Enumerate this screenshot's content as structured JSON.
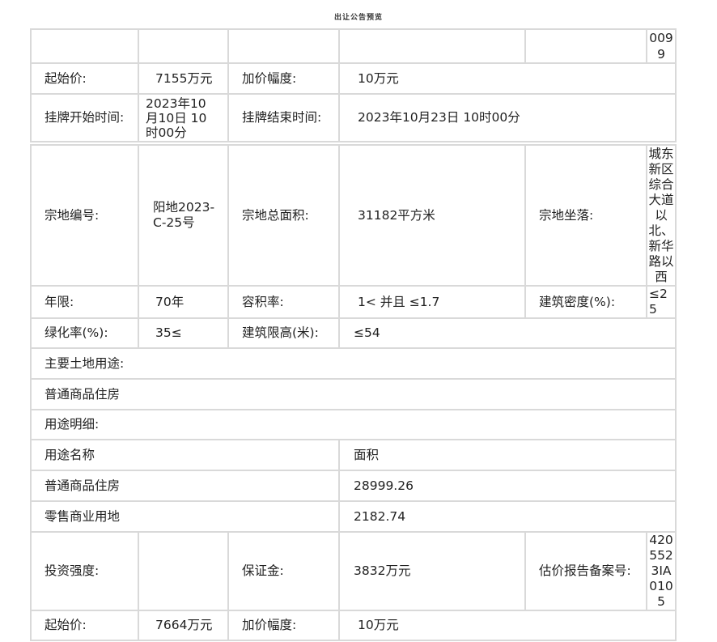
{
  "header": {
    "title": "出让公告预览"
  },
  "parcel_prev": {
    "code_tail": "0099",
    "start_price_label": "起始价:",
    "start_price": "7155万元",
    "increment_label": "加价幅度:",
    "increment": "10万元",
    "listing_start_label": "挂牌开始时间:",
    "listing_start": "2023年10月10日 10时00分",
    "listing_end_label": "挂牌结束时间:",
    "listing_end": "2023年10月23日 10时00分"
  },
  "parcel": {
    "id_label": "宗地编号:",
    "id": "阳地2023-C-25号",
    "area_label": "宗地总面积:",
    "area": "31182平方米",
    "location_label": "宗地坐落:",
    "location": "城东新区综合大道以北、新华路以西",
    "term_label": "年限:",
    "term": "70年",
    "far_label": "容积率:",
    "far": "1< 并且 ≤1.7",
    "density_label": "建筑密度(%):",
    "density": "≤25",
    "green_label": "绿化率(%):",
    "green": "35≤",
    "height_label": "建筑限高(米):",
    "height": "≤54",
    "main_use_label": "主要土地用途:",
    "main_use": "普通商品住房",
    "use_detail_label": "用途明细:",
    "use_table": {
      "headers": [
        "用途名称",
        "面积"
      ],
      "rows": [
        [
          "普通商品住房",
          "28999.26"
        ],
        [
          "零售商业用地",
          "2182.74"
        ]
      ]
    },
    "invest_label": "投资强度:",
    "invest": "",
    "deposit_label": "保证金:",
    "deposit": "3832万元",
    "appraisal_label": "估价报告备案号:",
    "appraisal": "4205523IA0105",
    "start_price_label": "起始价:",
    "start_price": "7664万元",
    "increment_label": "加价幅度:",
    "increment": "10万元"
  }
}
